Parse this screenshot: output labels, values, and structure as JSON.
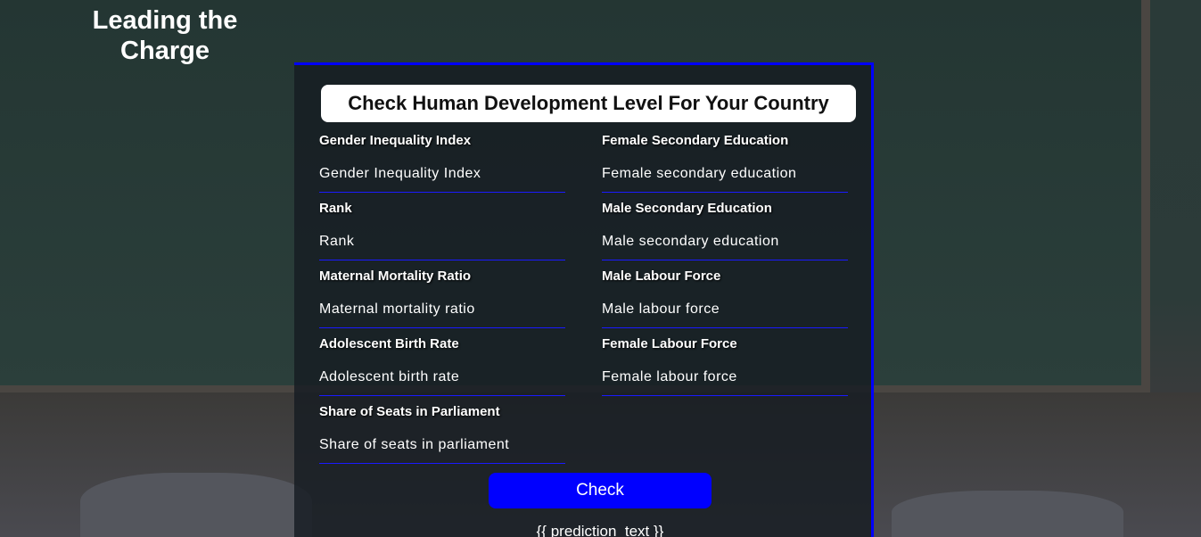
{
  "brand": {
    "title": "Leading the Charge"
  },
  "form": {
    "title": "Check Human Development Level For Your Country",
    "left_fields": [
      {
        "label": "Gender Inequality Index",
        "placeholder": "Gender Inequality Index"
      },
      {
        "label": "Rank",
        "placeholder": "Rank"
      },
      {
        "label": "Maternal Mortality Ratio",
        "placeholder": "Maternal mortality ratio"
      },
      {
        "label": "Adolescent Birth Rate",
        "placeholder": "Adolescent birth rate"
      },
      {
        "label": "Share of Seats in Parliament",
        "placeholder": "Share of seats in parliament"
      }
    ],
    "right_fields": [
      {
        "label": "Female Secondary Education",
        "placeholder": "Female secondary education"
      },
      {
        "label": "Male Secondary Education",
        "placeholder": "Male secondary education"
      },
      {
        "label": "Male Labour Force",
        "placeholder": "Male labour force"
      },
      {
        "label": "Female Labour Force",
        "placeholder": "Female labour force"
      }
    ],
    "submit_label": "Check",
    "prediction_text": "{{ prediction_text }}"
  },
  "colors": {
    "accent": "#0000ff",
    "panel_background": "rgba(22, 28, 34, 0.82)",
    "text": "#ffffff"
  }
}
